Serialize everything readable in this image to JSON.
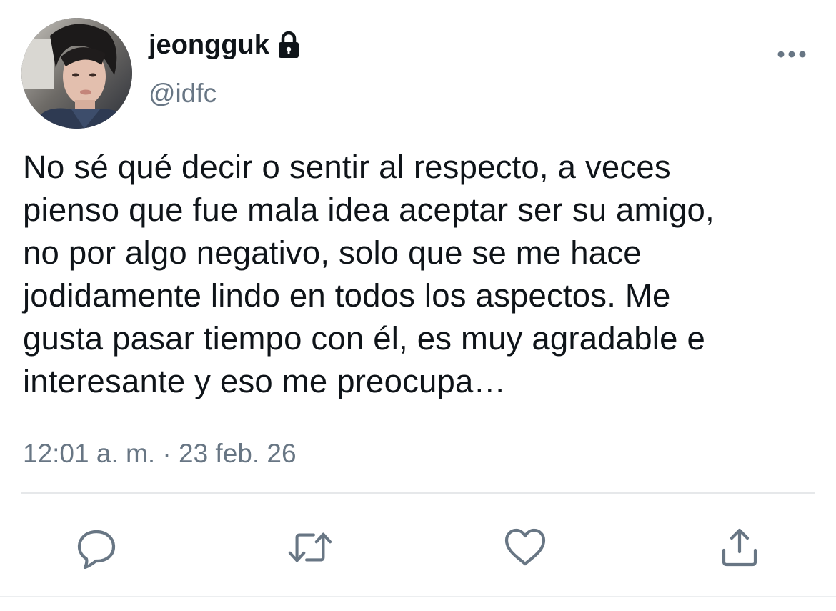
{
  "user": {
    "display_name": "jeongguk",
    "handle": "@idfc",
    "protected_icon": "lock-icon",
    "avatar_icon": "profile-photo"
  },
  "tweet": {
    "lines": [
      "No sé qué decir o sentir al respecto, a veces",
      "pienso que fue mala idea aceptar ser su amigo,",
      "no por algo negativo, solo que se me hace",
      "jodidamente lindo en todos los aspectos. Me",
      "gusta pasar tiempo con él, es muy agradable e",
      "interesante y eso me preocupa…"
    ],
    "timestamp": "12:01 a. m. · 23 feb. 26"
  },
  "actions": [
    {
      "name": "reply",
      "icon": "reply-icon"
    },
    {
      "name": "retweet",
      "icon": "retweet-icon"
    },
    {
      "name": "like",
      "icon": "heart-icon"
    },
    {
      "name": "share",
      "icon": "share-icon"
    }
  ],
  "menu": {
    "icon": "more-icon"
  },
  "colors": {
    "text": "#0f1419",
    "secondary": "#687684",
    "divider": "#e6e8ea"
  }
}
